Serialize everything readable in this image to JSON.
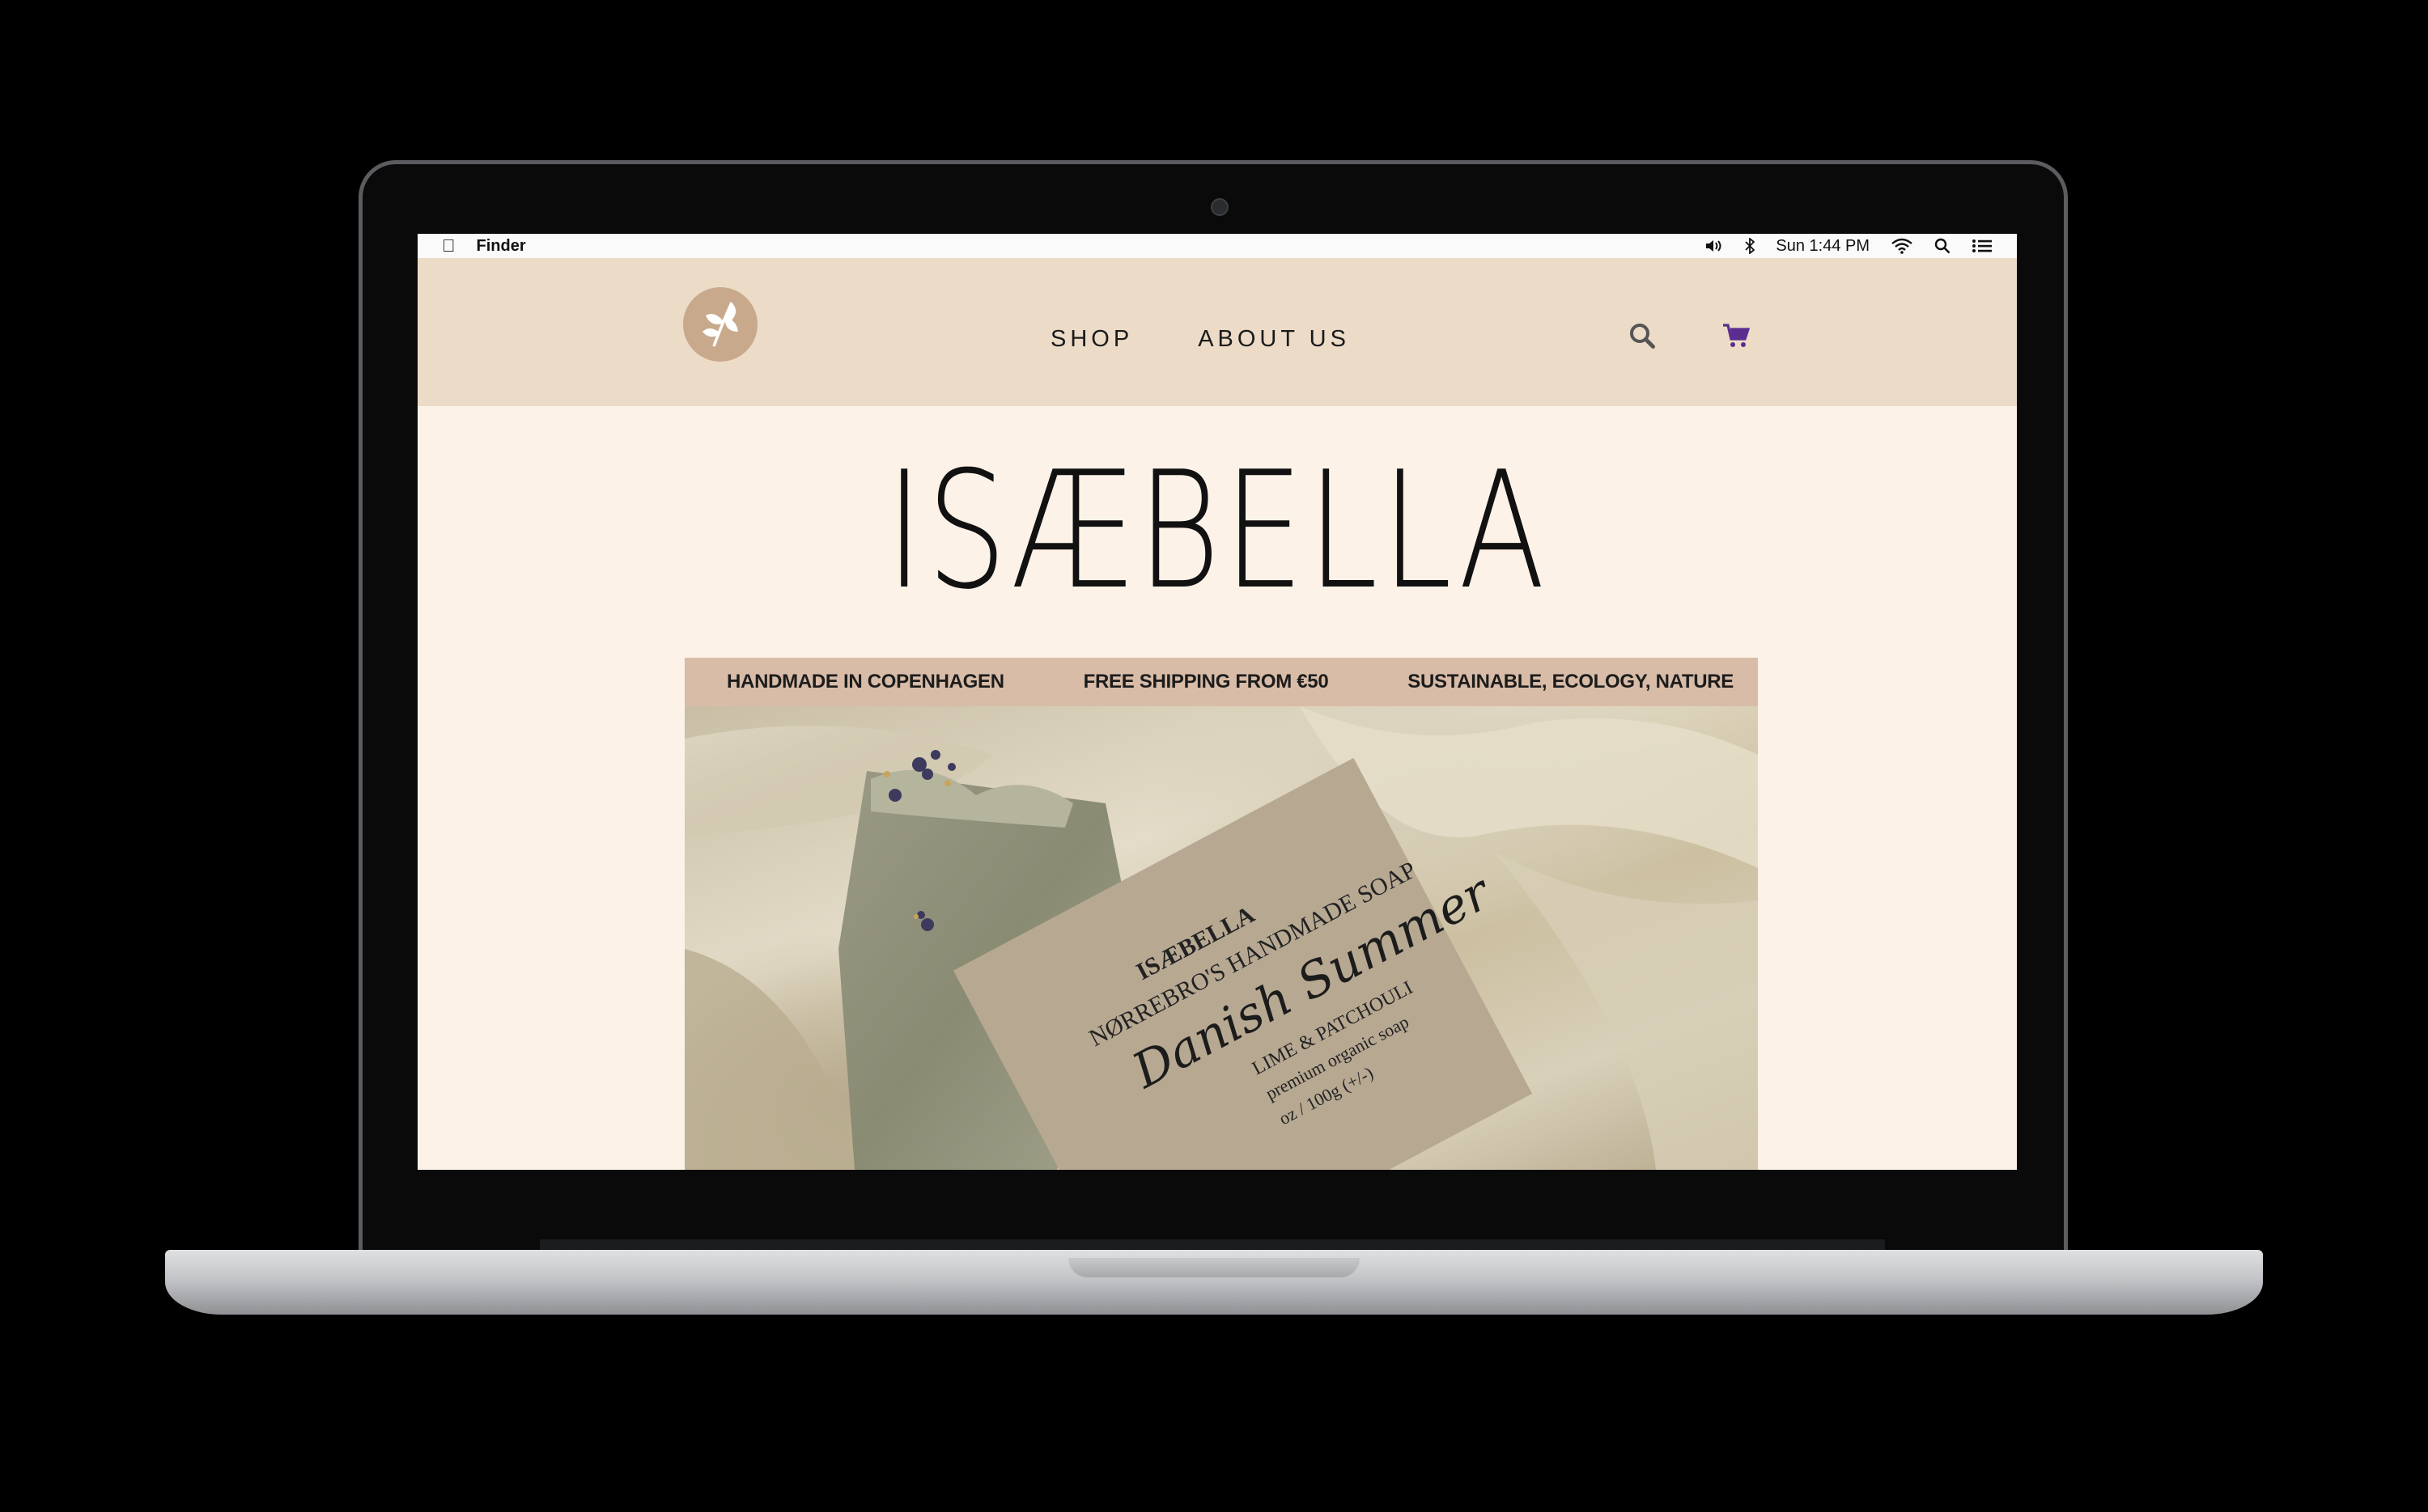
{
  "menubar": {
    "app_name": "Finder",
    "clock": "Sun 1:44 PM",
    "icons": [
      "apple-icon",
      "volume-icon",
      "bluetooth-icon",
      "wifi-icon",
      "spotlight-icon",
      "notification-list-icon"
    ]
  },
  "site": {
    "logo_icon": "leaf-icon",
    "nav": [
      "SHOP",
      "ABOUT US"
    ],
    "header_icons": [
      "search-icon",
      "cart-icon"
    ],
    "brand": "ISÆBELLA",
    "banner": [
      "HANDMADE IN COPENHAGEN",
      "FREE SHIPPING FROM €50",
      "SUSTAINABLE, ECOLOGY, NATURE"
    ],
    "hero_label": {
      "brand": "ISÆBELLA",
      "subtitle": "NØRREBRO'S HANDMADE SOAP",
      "name": "Danish Summer",
      "scent": "LIME & PATCHOULI",
      "note": "premium organic soap",
      "weight": "oz / 100g (+/-)"
    }
  },
  "colors": {
    "header_bg": "#ecdbc7",
    "page_bg": "#fcf2e7",
    "banner_bg": "#d8bca7",
    "logo_bg": "#c8a98c",
    "cart_accent": "#5b2d91"
  }
}
